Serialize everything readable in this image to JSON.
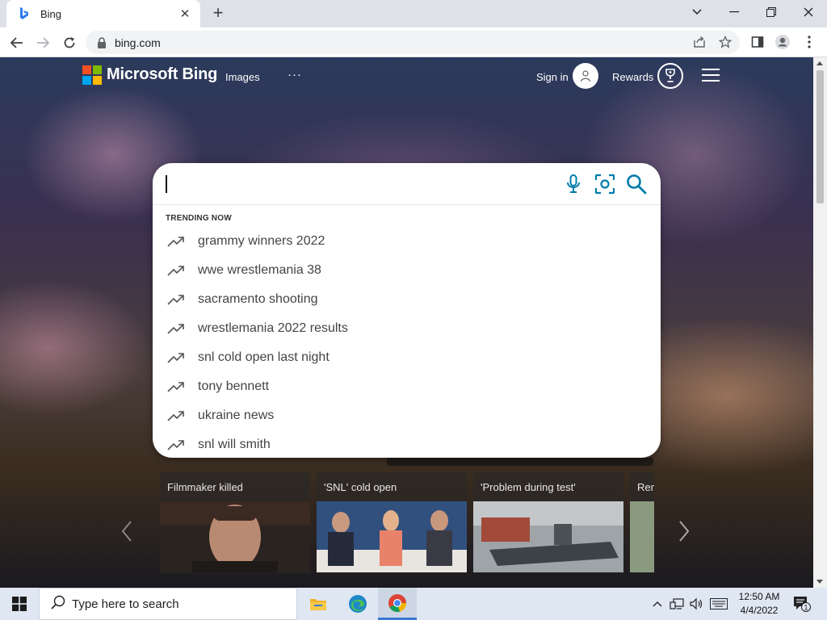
{
  "browser": {
    "tab_title": "Bing",
    "url": "bing.com"
  },
  "header": {
    "brand": "Microsoft Bing",
    "nav_images": "Images",
    "more": "···",
    "sign_in": "Sign in",
    "rewards": "Rewards"
  },
  "search": {
    "value": "",
    "trending_title": "TRENDING NOW",
    "suggestions": [
      "grammy winners 2022",
      "wwe wrestlemania 38",
      "sacramento shooting",
      "wrestlemania 2022 results",
      "snl cold open last night",
      "tony bennett",
      "ukraine news",
      "snl will smith"
    ]
  },
  "news": {
    "cards": [
      "Filmmaker killed",
      "'SNL' cold open",
      "'Problem during test'",
      "Ren"
    ]
  },
  "taskbar": {
    "search_placeholder": "Type here to search",
    "time": "12:50 AM",
    "date": "4/4/2022",
    "notification_count": "1"
  },
  "colors": {
    "ms_red": "#f25022",
    "ms_green": "#7fba00",
    "ms_blue": "#00a4ef",
    "ms_yellow": "#ffb900",
    "bing_teal": "#007daa"
  }
}
